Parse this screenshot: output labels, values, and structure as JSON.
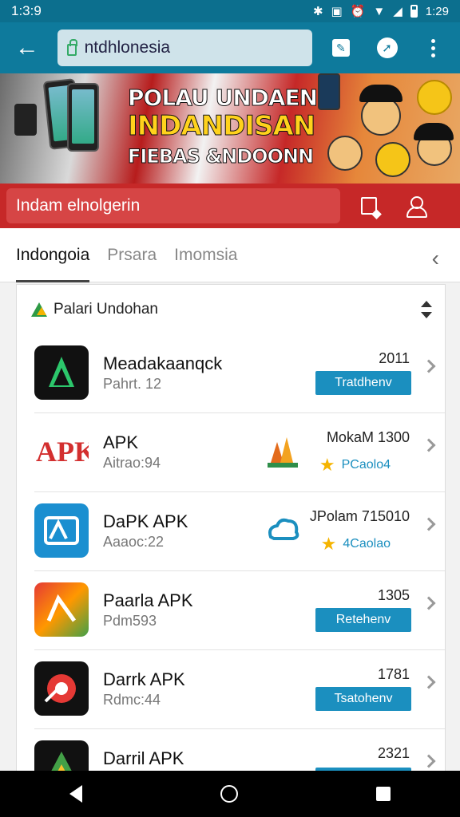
{
  "status_bar": {
    "time_left": "1:3:9",
    "time_right": "1:29"
  },
  "toolbar": {
    "url_text": "ntdhlonesia"
  },
  "banner": {
    "line1": "POLAU UNDAENI",
    "line2": "INDANDISAN",
    "line3": "FIEBAS &NDOONN"
  },
  "search_bar": {
    "text": "Indam elnolgerin"
  },
  "tabs": [
    {
      "label": "Indongoia",
      "active": true
    },
    {
      "label": "Prsara",
      "active": false
    },
    {
      "label": "Imomsia",
      "active": false
    }
  ],
  "list_header": {
    "title": "Palari Undohan"
  },
  "apps": [
    {
      "title": "Meadakaanqck",
      "subtitle": "Pahrt. 12",
      "number": "2011",
      "button": "Tratdhenv",
      "icon": "green-play-icon"
    },
    {
      "title": "APK",
      "subtitle": "Aitrao:94",
      "number": "MokaM 1300",
      "rating_text": "PCaolo4",
      "icon": "apk-logo-icon"
    },
    {
      "title": "DaPK APK",
      "subtitle": "Aaaoc:22",
      "number": "JPolam 715010",
      "rating_text": "4Caolao",
      "icon": "blue-apk-icon"
    },
    {
      "title": "Paarla APK",
      "subtitle": "Pdm593",
      "number": "1305",
      "button": "Retehenv",
      "icon": "colorful-play-icon"
    },
    {
      "title": "Darrk APK",
      "subtitle": "Rdmc:44",
      "number": "1781",
      "button": "Tsatohenv",
      "icon": "red-swirl-icon"
    },
    {
      "title": "Darril APK",
      "subtitle": "",
      "number": "2321",
      "button": "",
      "icon": "triangle-play-icon"
    }
  ],
  "colors": {
    "teal": "#0e7a9c",
    "red": "#c62828",
    "button_blue": "#1b8fbf"
  }
}
